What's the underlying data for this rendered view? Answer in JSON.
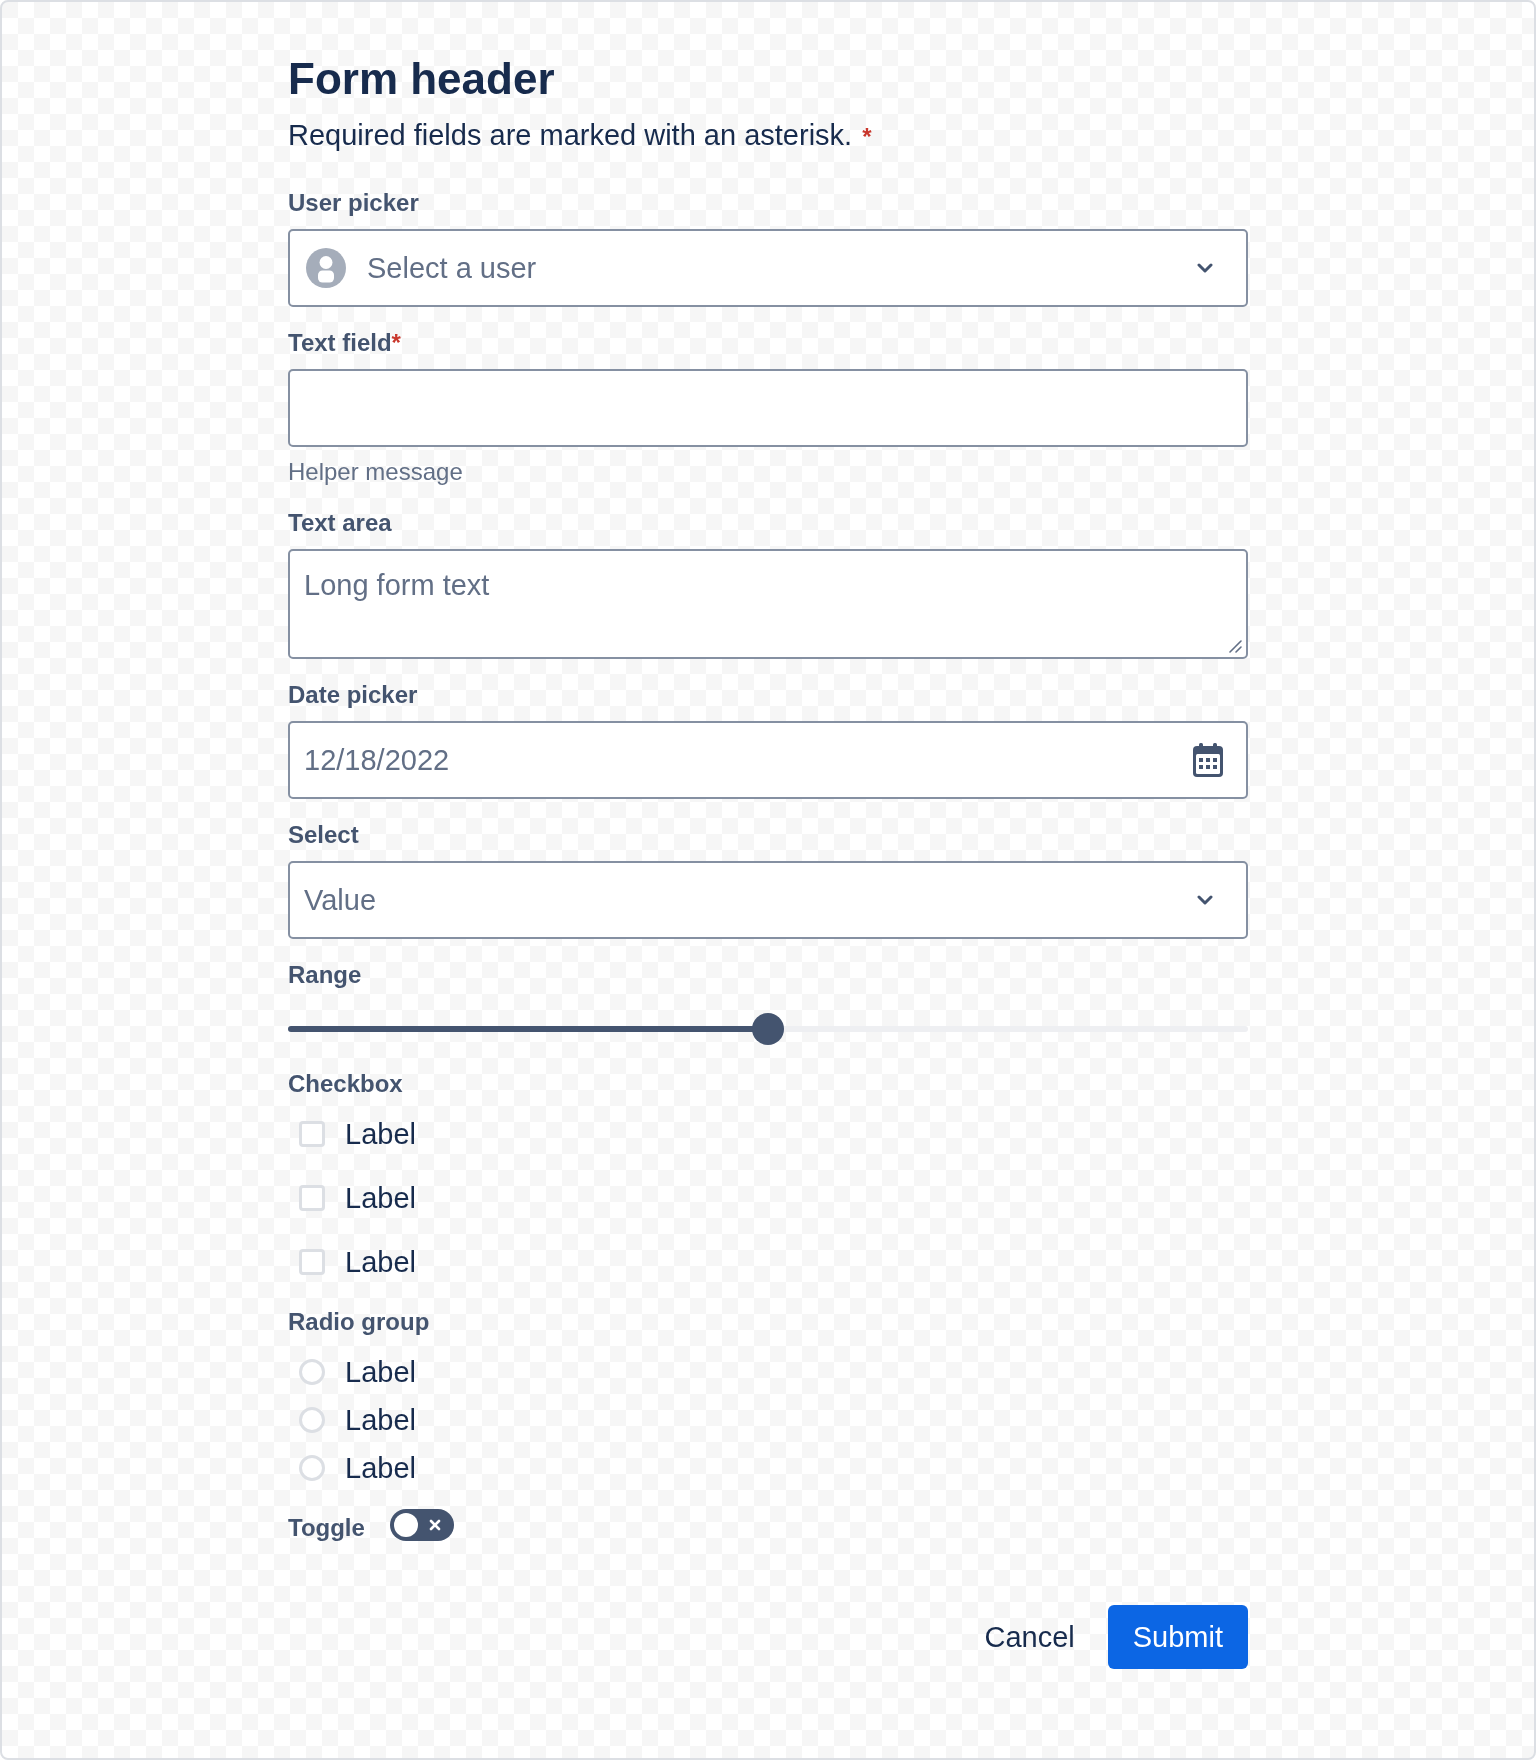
{
  "header": {
    "title": "Form header",
    "description": "Required fields are marked with an asterisk.",
    "required_mark": "*"
  },
  "fields": [
    {
      "kind": "user_picker",
      "label": "User picker",
      "placeholder": "Select a user"
    },
    {
      "kind": "text",
      "label": "Text field",
      "required_mark": "*",
      "helper": "Helper message"
    },
    {
      "kind": "textarea",
      "label": "Text area",
      "placeholder": "Long form text"
    },
    {
      "kind": "date",
      "label": "Date picker",
      "placeholder": "12/18/2022"
    },
    {
      "kind": "select",
      "label": "Select",
      "placeholder": "Value"
    },
    {
      "kind": "range",
      "label": "Range",
      "level": 0.5
    },
    {
      "kind": "checkbox_group",
      "label": "Checkbox",
      "options": [
        {
          "label": "Label",
          "checked": false
        },
        {
          "label": "Label",
          "checked": false
        },
        {
          "label": "Label",
          "checked": false
        }
      ]
    },
    {
      "kind": "radio_group",
      "label": "Radio group",
      "options": [
        {
          "label": "Label",
          "selected": false
        },
        {
          "label": "Label",
          "selected": false
        },
        {
          "label": "Label",
          "selected": false
        }
      ]
    },
    {
      "kind": "toggle",
      "label": "Toggle",
      "on": false
    }
  ],
  "actions": [
    {
      "label": "Cancel",
      "kind": "subtle"
    },
    {
      "label": "Submit",
      "kind": "primary"
    }
  ]
}
